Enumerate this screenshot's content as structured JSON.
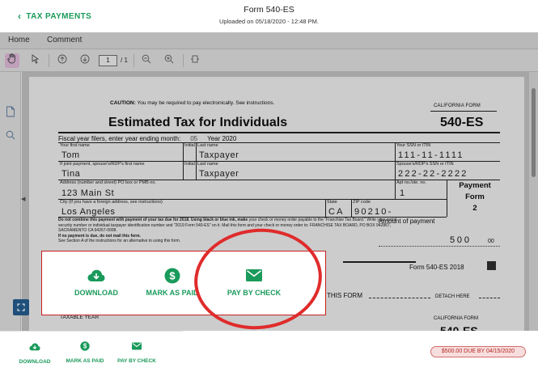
{
  "header": {
    "back_label": "TAX PAYMENTS",
    "title": "Form 540-ES",
    "subtitle": "Uploaded on 05/18/2020 - 12:48 PM."
  },
  "viewer": {
    "tabs": [
      "Home",
      "Comment"
    ],
    "page_input": "1",
    "page_total": "/ 1"
  },
  "document": {
    "caution_bold": "CAUTION:",
    "caution_text": " You may be required to pay electronically. See instructions.",
    "california_form": "CALIFORNIA FORM",
    "title": "Estimated Tax for Individuals",
    "form_number": "540-ES",
    "fiscal_text": "Fiscal year filers, enter year ending month:",
    "fiscal_month": "05",
    "fiscal_year_label": "Year",
    "fiscal_year": "2020",
    "labels": {
      "first_name": "Your first name",
      "initial": "Initial",
      "last_name": "Last name",
      "ssn": "Your SSN or ITIN",
      "spouse_first": "If joint payment, spouse's/RDP's first name",
      "spouse_initial": "Initial",
      "spouse_last": "Last name",
      "spouse_ssn": "Spouse's/RDP's SSN or ITIN",
      "address": "Address (number and street) PO box or PMB no.",
      "apt": "Apt no./ste. no.",
      "city": "City (If you have a foreign address, see instructions)",
      "state": "State",
      "zip": "ZIP code"
    },
    "values": {
      "first_name": "Tom",
      "last_name": "Taxpayer",
      "ssn": "111-11-1111",
      "spouse_first": "Tina",
      "spouse_last": "Taxpayer",
      "spouse_ssn": "222-22-2222",
      "address": "123 Main St",
      "apt": "1",
      "city": "Los Angeles",
      "state": "CA",
      "zip": "90210-"
    },
    "payment_form": [
      "Payment",
      "Form",
      "2"
    ],
    "notice_1_bold": "Do not combine this payment with payment of your tax due for 2018. Using black or blue ink, make",
    "notice_1_rest": " your check or money order payable to the \"Franchise Tax Board.\" Write your social security number or individual taxpayer identification number and \"2019 Form 540-ES\" on it. Mail this form and your check or money order to: FRANCHISE TAX BOARD, PO BOX 942867, SACRAMENTO CA 94267-0008.",
    "notice_2": "If no payment is due, do not mail this form.",
    "notice_3": "See Section A of the instructions for an alternative to using this form.",
    "amount_label": "Amount of payment",
    "amount_dollars": "500",
    "amount_cents": "00",
    "form_footer": "Form 540-ES  2018",
    "this_form": "THIS FORM",
    "detach_here": "DETACH HERE",
    "california_form_2": "CALIFORNIA FORM",
    "taxable_year": "TAXABLE YEAR",
    "form_number_2": "540-ES"
  },
  "actions": {
    "download": "DOWNLOAD",
    "mark_as_paid": "MARK AS PAID",
    "pay_by_check": "PAY BY CHECK"
  },
  "due_badge": "$500.00 DUE BY 04/15/2020",
  "colors": {
    "accent_green": "#1a9a5b",
    "highlight_red": "#e02b2b",
    "due_red": "#b3261e",
    "fullscreen_blue": "#1f4f7a"
  }
}
